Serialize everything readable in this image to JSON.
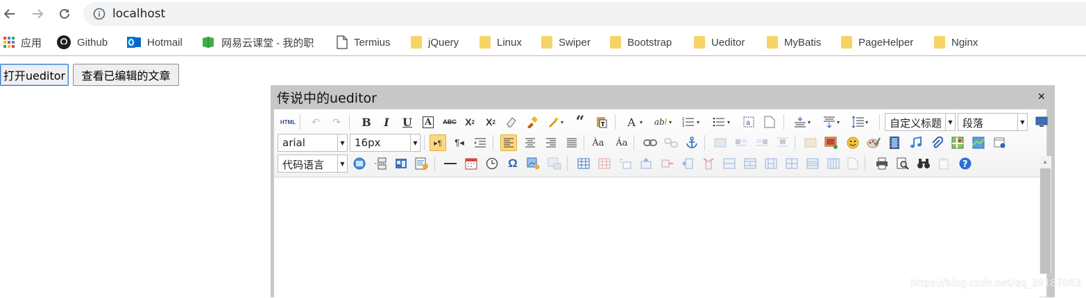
{
  "browser": {
    "url": "localhost",
    "bookmarks": [
      {
        "label": "应用",
        "icon": "apps-grid-icon"
      },
      {
        "label": "Github",
        "icon": "github-icon"
      },
      {
        "label": "Hotmail",
        "icon": "outlook-icon"
      },
      {
        "label": "网易云课堂 - 我的职",
        "icon": "netease-icon"
      },
      {
        "label": "Termius",
        "icon": "page-icon"
      },
      {
        "label": "jQuery",
        "icon": "folder-icon"
      },
      {
        "label": "Linux",
        "icon": "folder-icon"
      },
      {
        "label": "Swiper",
        "icon": "folder-icon"
      },
      {
        "label": "Bootstrap",
        "icon": "folder-icon"
      },
      {
        "label": "Ueditor",
        "icon": "folder-icon"
      },
      {
        "label": "MyBatis",
        "icon": "folder-icon"
      },
      {
        "label": "PageHelper",
        "icon": "folder-icon"
      },
      {
        "label": "Nginx",
        "icon": "folder-icon"
      }
    ]
  },
  "page": {
    "open_button": "打开ueditor",
    "view_button": "查看已编辑的文章"
  },
  "dialog": {
    "title": "传说中的ueditor",
    "close": "×"
  },
  "toolbar": {
    "html_label": "HTML",
    "custom_title": "自定义标题",
    "paragraph": "段落",
    "font_family": "arial",
    "font_size": "16px",
    "code_language": "代码语言"
  },
  "watermark": "https://blog.csdn.net/qq_39187063",
  "colors": {
    "folder": "#f6d365",
    "accent_blue": "#1a73e8",
    "selected_button": "#fcd87f"
  }
}
